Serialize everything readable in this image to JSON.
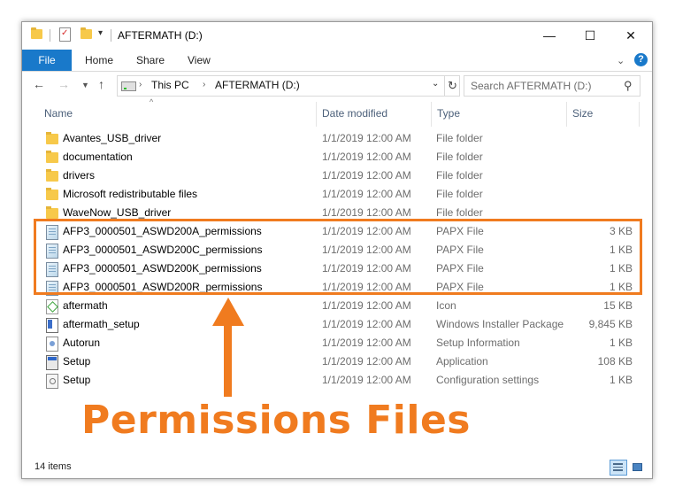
{
  "window": {
    "title": "AFTERMATH (D:)",
    "controls": {
      "minimize": "—",
      "maximize": "☐",
      "close": "✕"
    }
  },
  "ribbon": {
    "tabs": [
      "File",
      "Home",
      "Share",
      "View"
    ],
    "help": "?"
  },
  "address": {
    "crumbs": [
      "This PC",
      "AFTERMATH (D:)"
    ],
    "search_placeholder": "Search AFTERMATH (D:)"
  },
  "columns": {
    "name": "Name",
    "date": "Date modified",
    "type": "Type",
    "size": "Size"
  },
  "files": [
    {
      "name": "Avantes_USB_driver",
      "date": "1/1/2019 12:00 AM",
      "type": "File folder",
      "size": "",
      "icon": "folder-icon"
    },
    {
      "name": "documentation",
      "date": "1/1/2019 12:00 AM",
      "type": "File folder",
      "size": "",
      "icon": "folder-icon"
    },
    {
      "name": "drivers",
      "date": "1/1/2019 12:00 AM",
      "type": "File folder",
      "size": "",
      "icon": "folder-icon"
    },
    {
      "name": "Microsoft redistributable files",
      "date": "1/1/2019 12:00 AM",
      "type": "File folder",
      "size": "",
      "icon": "folder-icon"
    },
    {
      "name": "WaveNow_USB_driver",
      "date": "1/1/2019 12:00 AM",
      "type": "File folder",
      "size": "",
      "icon": "folder-icon"
    },
    {
      "name": "AFP3_0000501_ASWD200A_permissions",
      "date": "1/1/2019 12:00 AM",
      "type": "PAPX File",
      "size": "3 KB",
      "icon": "papx-file-icon"
    },
    {
      "name": "AFP3_0000501_ASWD200C_permissions",
      "date": "1/1/2019 12:00 AM",
      "type": "PAPX File",
      "size": "1 KB",
      "icon": "papx-file-icon"
    },
    {
      "name": "AFP3_0000501_ASWD200K_permissions",
      "date": "1/1/2019 12:00 AM",
      "type": "PAPX File",
      "size": "1 KB",
      "icon": "papx-file-icon"
    },
    {
      "name": "AFP3_0000501_ASWD200R_permissions",
      "date": "1/1/2019 12:00 AM",
      "type": "PAPX File",
      "size": "1 KB",
      "icon": "papx-file-icon"
    },
    {
      "name": "aftermath",
      "date": "1/1/2019 12:00 AM",
      "type": "Icon",
      "size": "15 KB",
      "icon": "icon-file-icon"
    },
    {
      "name": "aftermath_setup",
      "date": "1/1/2019 12:00 AM",
      "type": "Windows Installer Package",
      "size": "9,845 KB",
      "icon": "installer-icon"
    },
    {
      "name": "Autorun",
      "date": "1/1/2019 12:00 AM",
      "type": "Setup Information",
      "size": "1 KB",
      "icon": "setup-info-icon"
    },
    {
      "name": "Setup",
      "date": "1/1/2019 12:00 AM",
      "type": "Application",
      "size": "108 KB",
      "icon": "application-icon"
    },
    {
      "name": "Setup",
      "date": "1/1/2019 12:00 AM",
      "type": "Configuration settings",
      "size": "1 KB",
      "icon": "config-file-icon"
    }
  ],
  "status": {
    "item_count": "14 items"
  },
  "annotation": {
    "label": "Permissions Files",
    "color": "#f07b1f"
  },
  "colors": {
    "accent": "#1979ca",
    "highlight": "#f07b1f"
  }
}
